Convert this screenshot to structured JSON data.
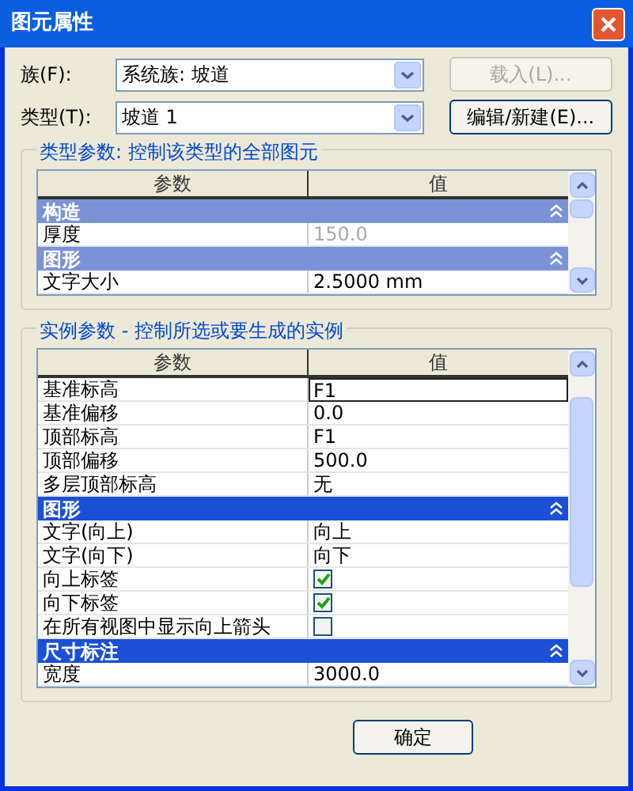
{
  "window": {
    "title": "图元属性"
  },
  "family": {
    "label": "族(F):",
    "value": "系统族: 坡道",
    "button": {
      "label": "载入(L)...",
      "disabled": true
    }
  },
  "type": {
    "label": "类型(T):",
    "value": "坡道 1",
    "button": {
      "label": "编辑/新建(E)...",
      "disabled": false
    }
  },
  "type_params": {
    "title": "类型参数: 控制该类型的全部图元",
    "focused": false,
    "columns": [
      "参数",
      "值"
    ],
    "rows": [
      {
        "kind": "group",
        "label": "构造",
        "expanded": true
      },
      {
        "kind": "text",
        "name": "厚度",
        "value": "150.0",
        "disabled": true
      },
      {
        "kind": "group",
        "label": "图形",
        "expanded": true
      },
      {
        "kind": "text",
        "name": "文字大小",
        "value": "2.5000 mm"
      }
    ]
  },
  "instance_params": {
    "title": "实例参数 - 控制所选或要生成的实例",
    "focused": true,
    "columns": [
      "参数",
      "值"
    ],
    "rows": [
      {
        "kind": "field",
        "name": "基准标高",
        "value": "F1"
      },
      {
        "kind": "text",
        "name": "基准偏移",
        "value": "0.0"
      },
      {
        "kind": "text",
        "name": "顶部标高",
        "value": "F1"
      },
      {
        "kind": "text",
        "name": "顶部偏移",
        "value": "500.0"
      },
      {
        "kind": "text",
        "name": "多层顶部标高",
        "value": "无"
      },
      {
        "kind": "group",
        "label": "图形",
        "expanded": true
      },
      {
        "kind": "text",
        "name": "文字(向上)",
        "value": "向上"
      },
      {
        "kind": "text",
        "name": "文字(向下)",
        "value": "向下"
      },
      {
        "kind": "check",
        "name": "向上标签",
        "checked": true
      },
      {
        "kind": "check",
        "name": "向下标签",
        "checked": true
      },
      {
        "kind": "check",
        "name": "在所有视图中显示向上箭头",
        "checked": false
      },
      {
        "kind": "group",
        "label": "尺寸标注",
        "expanded": true
      },
      {
        "kind": "text",
        "name": "宽度",
        "value": "3000.0"
      }
    ]
  },
  "buttons": [
    "确定"
  ]
}
